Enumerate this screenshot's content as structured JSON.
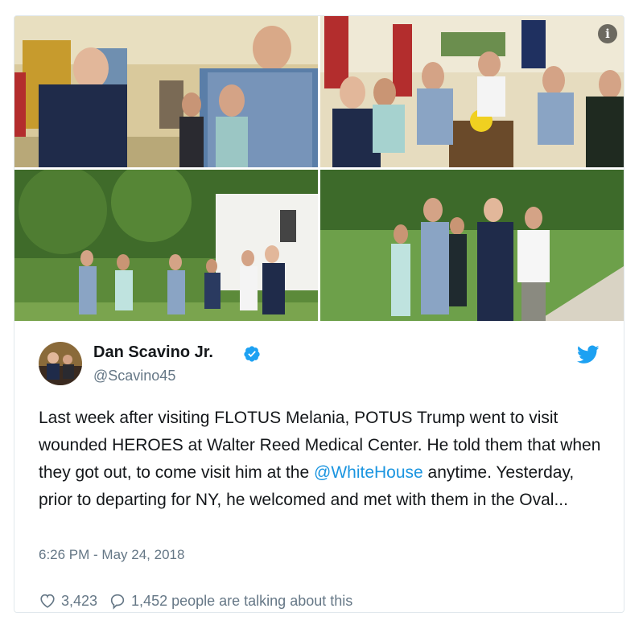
{
  "media": {
    "photos": [
      {
        "scene": "oval-office-handshake"
      },
      {
        "scene": "oval-office-meeting"
      },
      {
        "scene": "south-lawn-walk"
      },
      {
        "scene": "lawn-greeting"
      }
    ],
    "info_icon": "info-icon"
  },
  "tweet": {
    "author_name": "Dan Scavino Jr.",
    "handle": "@Scavino45",
    "verified": true,
    "text_before": "Last week after visiting FLOTUS Melania, POTUS Trump went to visit wounded HEROES at Walter Reed Medical Center. He told them that when they got out, to come visit him at the ",
    "mention": "@WhiteHouse",
    "text_after": " anytime. Yesterday, prior to departing for NY, he welcomed and met with them in the Oval...",
    "timestamp": "6:26 PM - May 24, 2018",
    "likes": "3,423",
    "talking": "1,452 people are talking about this"
  },
  "colors": {
    "accent": "#1da1f2",
    "mention": "#1b95e0",
    "muted": "#657786",
    "text": "#14171a",
    "border": "#e1e8ed"
  }
}
